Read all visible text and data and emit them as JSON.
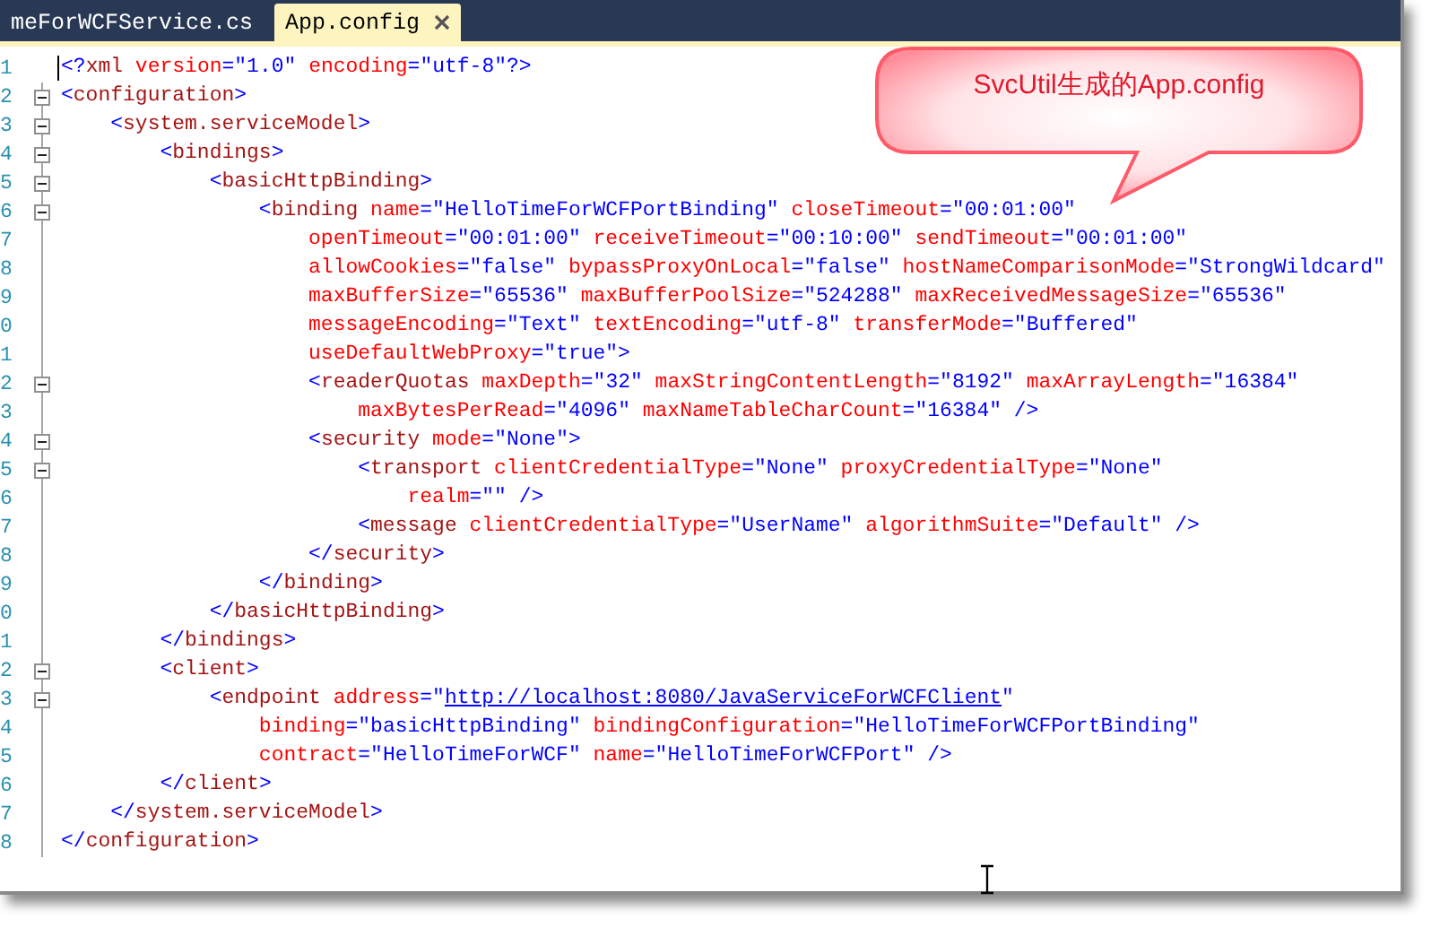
{
  "tabs": [
    {
      "label": "meForWCFService.cs",
      "selected": false
    },
    {
      "label": "App.config",
      "selected": true
    }
  ],
  "editor": {
    "lines": [
      {
        "number": "1",
        "fold_marker": false,
        "tokens": [
          {
            "kind": "markup",
            "text": "<?"
          },
          {
            "kind": "element",
            "text": "xml"
          },
          {
            "kind": "attribute",
            "text": " version"
          },
          {
            "kind": "markup",
            "text": "=\"1.0\""
          },
          {
            "kind": "attribute",
            "text": " encoding"
          },
          {
            "kind": "markup",
            "text": "=\"utf-8\"?>"
          }
        ]
      },
      {
        "number": "2",
        "fold_marker": true,
        "tokens": [
          {
            "kind": "markup",
            "text": "<"
          },
          {
            "kind": "element",
            "text": "configuration"
          },
          {
            "kind": "markup",
            "text": ">"
          }
        ]
      },
      {
        "number": "3",
        "fold_marker": true,
        "tokens": [
          {
            "kind": "markup",
            "text": "    <"
          },
          {
            "kind": "element",
            "text": "system.serviceModel"
          },
          {
            "kind": "markup",
            "text": ">"
          }
        ]
      },
      {
        "number": "4",
        "fold_marker": true,
        "tokens": [
          {
            "kind": "markup",
            "text": "        <"
          },
          {
            "kind": "element",
            "text": "bindings"
          },
          {
            "kind": "markup",
            "text": ">"
          }
        ]
      },
      {
        "number": "5",
        "fold_marker": true,
        "tokens": [
          {
            "kind": "markup",
            "text": "            <"
          },
          {
            "kind": "element",
            "text": "basicHttpBinding"
          },
          {
            "kind": "markup",
            "text": ">"
          }
        ]
      },
      {
        "number": "6",
        "fold_marker": true,
        "tokens": [
          {
            "kind": "markup",
            "text": "                <"
          },
          {
            "kind": "element",
            "text": "binding"
          },
          {
            "kind": "attribute",
            "text": " name"
          },
          {
            "kind": "markup",
            "text": "=\"HelloTimeForWCFPortBinding\""
          },
          {
            "kind": "attribute",
            "text": " closeTimeout"
          },
          {
            "kind": "markup",
            "text": "=\"00:01:00\""
          }
        ]
      },
      {
        "number": "7",
        "fold_marker": false,
        "tokens": [
          {
            "kind": "attribute",
            "text": "                    openTimeout"
          },
          {
            "kind": "markup",
            "text": "=\"00:01:00\""
          },
          {
            "kind": "attribute",
            "text": " receiveTimeout"
          },
          {
            "kind": "markup",
            "text": "=\"00:10:00\""
          },
          {
            "kind": "attribute",
            "text": " sendTimeout"
          },
          {
            "kind": "markup",
            "text": "=\"00:01:00\""
          }
        ]
      },
      {
        "number": "8",
        "fold_marker": false,
        "tokens": [
          {
            "kind": "attribute",
            "text": "                    allowCookies"
          },
          {
            "kind": "markup",
            "text": "=\"false\""
          },
          {
            "kind": "attribute",
            "text": " bypassProxyOnLocal"
          },
          {
            "kind": "markup",
            "text": "=\"false\""
          },
          {
            "kind": "attribute",
            "text": " hostNameComparisonMode"
          },
          {
            "kind": "markup",
            "text": "=\"StrongWildcard\""
          }
        ]
      },
      {
        "number": "9",
        "fold_marker": false,
        "tokens": [
          {
            "kind": "attribute",
            "text": "                    maxBufferSize"
          },
          {
            "kind": "markup",
            "text": "=\"65536\""
          },
          {
            "kind": "attribute",
            "text": " maxBufferPoolSize"
          },
          {
            "kind": "markup",
            "text": "=\"524288\""
          },
          {
            "kind": "attribute",
            "text": " maxReceivedMessageSize"
          },
          {
            "kind": "markup",
            "text": "=\"65536\""
          }
        ]
      },
      {
        "number": "0",
        "fold_marker": false,
        "tokens": [
          {
            "kind": "attribute",
            "text": "                    messageEncoding"
          },
          {
            "kind": "markup",
            "text": "=\"Text\""
          },
          {
            "kind": "attribute",
            "text": " textEncoding"
          },
          {
            "kind": "markup",
            "text": "=\"utf-8\""
          },
          {
            "kind": "attribute",
            "text": " transferMode"
          },
          {
            "kind": "markup",
            "text": "=\"Buffered\""
          }
        ]
      },
      {
        "number": "1",
        "fold_marker": false,
        "tokens": [
          {
            "kind": "attribute",
            "text": "                    useDefaultWebProxy"
          },
          {
            "kind": "markup",
            "text": "=\"true\">"
          }
        ]
      },
      {
        "number": "2",
        "fold_marker": true,
        "tokens": [
          {
            "kind": "markup",
            "text": "                    <"
          },
          {
            "kind": "element",
            "text": "readerQuotas"
          },
          {
            "kind": "attribute",
            "text": " maxDepth"
          },
          {
            "kind": "markup",
            "text": "=\"32\""
          },
          {
            "kind": "attribute",
            "text": " maxStringContentLength"
          },
          {
            "kind": "markup",
            "text": "=\"8192\""
          },
          {
            "kind": "attribute",
            "text": " maxArrayLength"
          },
          {
            "kind": "markup",
            "text": "=\"16384\""
          }
        ]
      },
      {
        "number": "3",
        "fold_marker": false,
        "tokens": [
          {
            "kind": "attribute",
            "text": "                        maxBytesPerRead"
          },
          {
            "kind": "markup",
            "text": "=\"4096\""
          },
          {
            "kind": "attribute",
            "text": " maxNameTableCharCount"
          },
          {
            "kind": "markup",
            "text": "=\"16384\" />"
          }
        ]
      },
      {
        "number": "4",
        "fold_marker": true,
        "tokens": [
          {
            "kind": "markup",
            "text": "                    <"
          },
          {
            "kind": "element",
            "text": "security"
          },
          {
            "kind": "attribute",
            "text": " mode"
          },
          {
            "kind": "markup",
            "text": "=\"None\">"
          }
        ]
      },
      {
        "number": "5",
        "fold_marker": true,
        "tokens": [
          {
            "kind": "markup",
            "text": "                        <"
          },
          {
            "kind": "element",
            "text": "transport"
          },
          {
            "kind": "attribute",
            "text": " clientCredentialType"
          },
          {
            "kind": "markup",
            "text": "=\"None\""
          },
          {
            "kind": "attribute",
            "text": " proxyCredentialType"
          },
          {
            "kind": "markup",
            "text": "=\"None\""
          }
        ]
      },
      {
        "number": "6",
        "fold_marker": false,
        "tokens": [
          {
            "kind": "attribute",
            "text": "                            realm"
          },
          {
            "kind": "markup",
            "text": "=\"\" />"
          }
        ]
      },
      {
        "number": "7",
        "fold_marker": false,
        "tokens": [
          {
            "kind": "markup",
            "text": "                        <"
          },
          {
            "kind": "element",
            "text": "message"
          },
          {
            "kind": "attribute",
            "text": " clientCredentialType"
          },
          {
            "kind": "markup",
            "text": "=\"UserName\""
          },
          {
            "kind": "attribute",
            "text": " algorithmSuite"
          },
          {
            "kind": "markup",
            "text": "=\"Default\" />"
          }
        ]
      },
      {
        "number": "8",
        "fold_marker": false,
        "tokens": [
          {
            "kind": "markup",
            "text": "                    </"
          },
          {
            "kind": "element",
            "text": "security"
          },
          {
            "kind": "markup",
            "text": ">"
          }
        ]
      },
      {
        "number": "9",
        "fold_marker": false,
        "tokens": [
          {
            "kind": "markup",
            "text": "                </"
          },
          {
            "kind": "element",
            "text": "binding"
          },
          {
            "kind": "markup",
            "text": ">"
          }
        ]
      },
      {
        "number": "0",
        "fold_marker": false,
        "tokens": [
          {
            "kind": "markup",
            "text": "            </"
          },
          {
            "kind": "element",
            "text": "basicHttpBinding"
          },
          {
            "kind": "markup",
            "text": ">"
          }
        ]
      },
      {
        "number": "1",
        "fold_marker": false,
        "tokens": [
          {
            "kind": "markup",
            "text": "        </"
          },
          {
            "kind": "element",
            "text": "bindings"
          },
          {
            "kind": "markup",
            "text": ">"
          }
        ]
      },
      {
        "number": "2",
        "fold_marker": true,
        "tokens": [
          {
            "kind": "markup",
            "text": "        <"
          },
          {
            "kind": "element",
            "text": "client"
          },
          {
            "kind": "markup",
            "text": ">"
          }
        ]
      },
      {
        "number": "3",
        "fold_marker": true,
        "tokens": [
          {
            "kind": "markup",
            "text": "            <"
          },
          {
            "kind": "element",
            "text": "endpoint"
          },
          {
            "kind": "attribute",
            "text": " address"
          },
          {
            "kind": "markup",
            "text": "=\""
          },
          {
            "kind": "link",
            "text": "http://localhost:8080/JavaServiceForWCFClient"
          },
          {
            "kind": "markup",
            "text": "\""
          }
        ]
      },
      {
        "number": "4",
        "fold_marker": false,
        "tokens": [
          {
            "kind": "attribute",
            "text": "                binding"
          },
          {
            "kind": "markup",
            "text": "=\"basicHttpBinding\""
          },
          {
            "kind": "attribute",
            "text": " bindingConfiguration"
          },
          {
            "kind": "markup",
            "text": "=\"HelloTimeForWCFPortBinding\""
          }
        ]
      },
      {
        "number": "5",
        "fold_marker": false,
        "tokens": [
          {
            "kind": "attribute",
            "text": "                contract"
          },
          {
            "kind": "markup",
            "text": "=\"HelloTimeForWCF\""
          },
          {
            "kind": "attribute",
            "text": " name"
          },
          {
            "kind": "markup",
            "text": "=\"HelloTimeForWCFPort\" />"
          }
        ]
      },
      {
        "number": "6",
        "fold_marker": false,
        "tokens": [
          {
            "kind": "markup",
            "text": "        </"
          },
          {
            "kind": "element",
            "text": "client"
          },
          {
            "kind": "markup",
            "text": ">"
          }
        ]
      },
      {
        "number": "7",
        "fold_marker": false,
        "tokens": [
          {
            "kind": "markup",
            "text": "    </"
          },
          {
            "kind": "element",
            "text": "system.serviceModel"
          },
          {
            "kind": "markup",
            "text": ">"
          }
        ]
      },
      {
        "number": "8",
        "fold_marker": false,
        "tokens": [
          {
            "kind": "markup",
            "text": "</"
          },
          {
            "kind": "element",
            "text": "configuration"
          },
          {
            "kind": "markup",
            "text": ">"
          }
        ]
      }
    ]
  },
  "callout": {
    "text": "SvcUtil生成的App.config"
  }
}
